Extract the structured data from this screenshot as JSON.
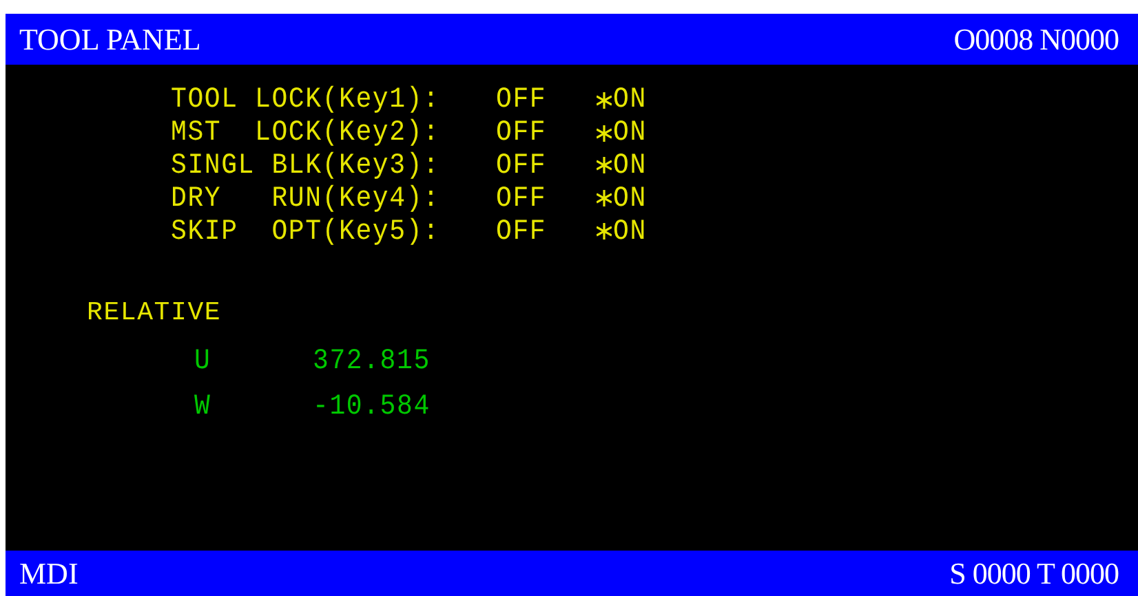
{
  "header": {
    "title": "TOOL PANEL",
    "program": "O0008 N0000"
  },
  "switches": [
    {
      "label": "TOOL LOCK(Key1):",
      "options": [
        {
          "label": "OFF",
          "selected": false
        },
        {
          "label": "ON",
          "selected": true
        }
      ]
    },
    {
      "label": "MST  LOCK(Key2):",
      "options": [
        {
          "label": "OFF",
          "selected": false
        },
        {
          "label": "ON",
          "selected": true
        }
      ]
    },
    {
      "label": "SINGL BLK(Key3):",
      "options": [
        {
          "label": "OFF",
          "selected": false
        },
        {
          "label": "ON",
          "selected": true
        }
      ]
    },
    {
      "label": "DRY   RUN(Key4):",
      "options": [
        {
          "label": "OFF",
          "selected": false
        },
        {
          "label": "ON",
          "selected": true
        }
      ]
    },
    {
      "label": "SKIP  OPT(Key5):",
      "options": [
        {
          "label": "OFF",
          "selected": false
        },
        {
          "label": "ON",
          "selected": true
        }
      ]
    }
  ],
  "relative": {
    "title": "RELATIVE",
    "axes": [
      {
        "axis": "U",
        "value": "372.815"
      },
      {
        "axis": "W",
        "value": "-10.584"
      }
    ]
  },
  "footer": {
    "mode": "MDI",
    "spindle_tool": "S 0000 T 0000"
  }
}
